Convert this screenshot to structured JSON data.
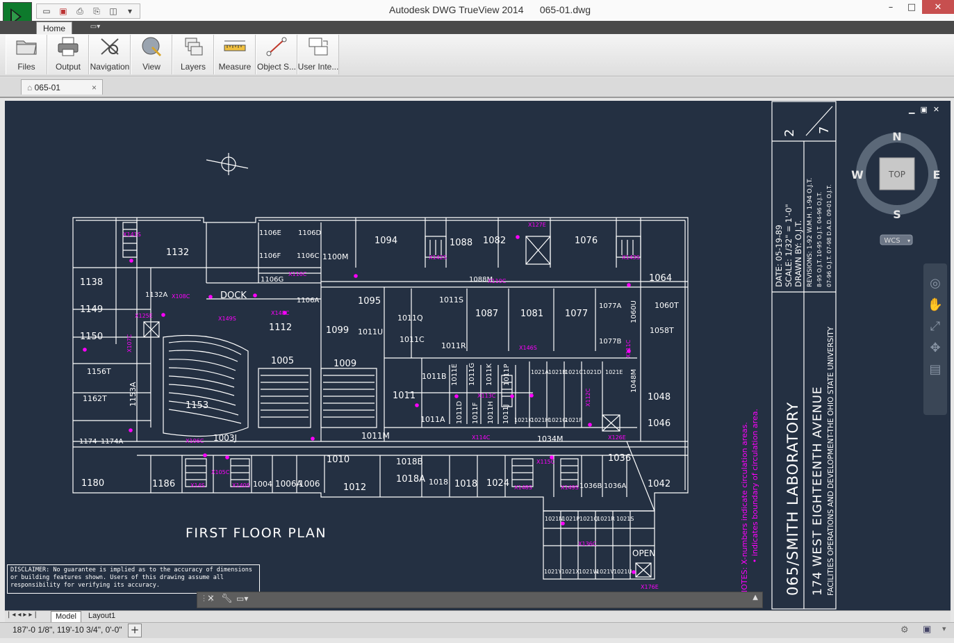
{
  "window": {
    "title": "Autodesk DWG TrueView 2014      065-01.dwg",
    "controls": [
      "minimize",
      "maximize",
      "close"
    ]
  },
  "quick_access": {
    "icons": [
      "open-icon",
      "save-as-icon",
      "print-icon",
      "batch-plot-icon",
      "preview-icon",
      "dropdown-icon"
    ]
  },
  "ribbon": {
    "tab_home": "Home",
    "panels": [
      {
        "label": "Files",
        "icon": "folder-icon"
      },
      {
        "label": "Output",
        "icon": "printer-icon"
      },
      {
        "label": "Navigation",
        "icon": "navigation-icon"
      },
      {
        "label": "View",
        "icon": "view-icon"
      },
      {
        "label": "Layers",
        "icon": "layers-icon"
      },
      {
        "label": "Measure",
        "icon": "ruler-icon"
      },
      {
        "label": "Object S...",
        "icon": "object-snap-icon"
      },
      {
        "label": "User Inte...",
        "icon": "user-interface-icon"
      }
    ]
  },
  "document_tab": {
    "label": "065-01",
    "close": "×"
  },
  "drawing": {
    "plan_title": "FIRST FLOOR PLAN",
    "disclaimer": "DISCLAIMER: No guarantee is implied as to the accuracy of dimensions or building features shown. Users of this drawing assume all responsibility for verifying its accuracy.",
    "notes_1": "NOTES: X-numbers indicate circulation areas.",
    "notes_2": "• indicates boundary of circulation area.",
    "titleblock": {
      "sheet": "2/7",
      "date": "DATE: 05-19-89",
      "scale": "SCALE: 1/32\" = 1'-0\"",
      "drawn_by": "DRAWN BY: O.J.T.",
      "revisions": "REVISIONS: 1-92 W.M.H.  1-94 O.J.T.",
      "rev_2": "8-95 O.J.T. 10-95 O.J.T. 04-96 O.J.T.",
      "rev_3": "07-96 O.J.T. 07-98 D.A.D. 09-01 O.J.T.",
      "building": "065/SMITH LABORATORY",
      "address": "174 WEST EIGHTEENTH AVENUE",
      "department": "FACILITIES OPERATIONS AND DEVELOPMENT-THE OHIO STATE UNIVERSITY"
    },
    "rooms": [
      "1138",
      "1149",
      "1150",
      "1156T",
      "1162T",
      "1174",
      "1174A",
      "1180",
      "1186",
      "1132",
      "1132A",
      "DOCK",
      "1112",
      "1106E",
      "1106D",
      "1106F",
      "1106C",
      "1106G",
      "1106A",
      "1100M",
      "1094",
      "1088",
      "1082",
      "1076",
      "1064",
      "1060T",
      "1058T",
      "1048",
      "1046",
      "1042",
      "1036",
      "1036A",
      "1036B",
      "1034M",
      "1024",
      "1018",
      "1018A",
      "1018B",
      "1012",
      "1010",
      "1006",
      "1006A",
      "1004",
      "1003J",
      "1005",
      "1009",
      "1099",
      "1095",
      "1011U",
      "1011Q",
      "1011S",
      "1011R",
      "1011C",
      "1011B",
      "1011A",
      "1011",
      "1011M",
      "1087",
      "1081",
      "1077",
      "1077A",
      "1077B",
      "1060U",
      "1048M",
      "1153",
      "1153A",
      "1088M",
      "1011E",
      "1011G",
      "1011K",
      "1011P",
      "1011D",
      "1011F",
      "1011H",
      "1011J",
      "1021A",
      "1021B",
      "1021C",
      "1021D",
      "1021E",
      "1021K",
      "1021H",
      "1021G",
      "1021F",
      "1021N",
      "1021P",
      "1021Q",
      "1021R",
      "1021S",
      "1021Y",
      "1021X",
      "1021W",
      "1021V",
      "1021U",
      "OPEN"
    ]
  },
  "viewcube": {
    "north": "N",
    "south": "S",
    "east": "E",
    "west": "W",
    "face": "TOP",
    "ucs": "WCS"
  },
  "layout_tabs": {
    "model": "Model",
    "layout1": "Layout1"
  },
  "status": {
    "coordinates": "187'-0 1/8\",  119'-10 3/4\", 0'-0\""
  },
  "colors": {
    "canvas_bg": "#243042",
    "linework": "#ffffff",
    "magenta": "#ff00ff"
  }
}
